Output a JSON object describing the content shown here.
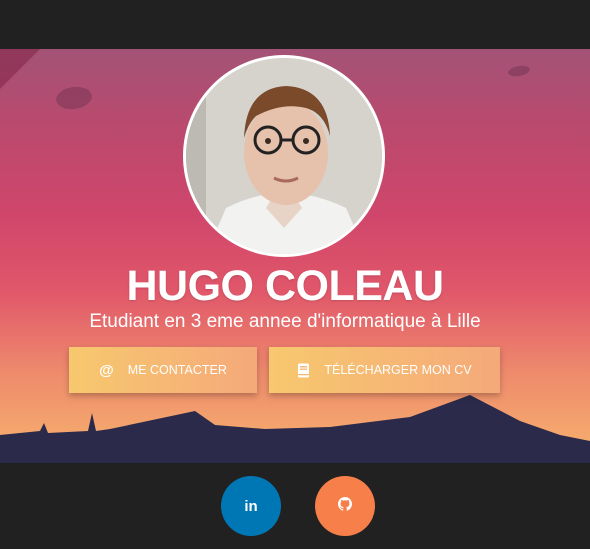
{
  "profile": {
    "name": "HUGO COLEAU",
    "subtitle": "Etudiant en 3 eme annee d'informatique à Lille"
  },
  "buttons": {
    "contact_label": "ME CONTACTER",
    "contact_icon": "@",
    "cv_label": "TÉLÉCHARGER MON CV"
  },
  "social": {
    "linkedin_label": "in",
    "github_icon": "github-icon"
  },
  "colors": {
    "background": "#212121",
    "button_gradient_start": "#f7c86e",
    "button_gradient_end": "#f5a97a",
    "linkedin": "#0077b5",
    "github": "#f77f4a"
  }
}
